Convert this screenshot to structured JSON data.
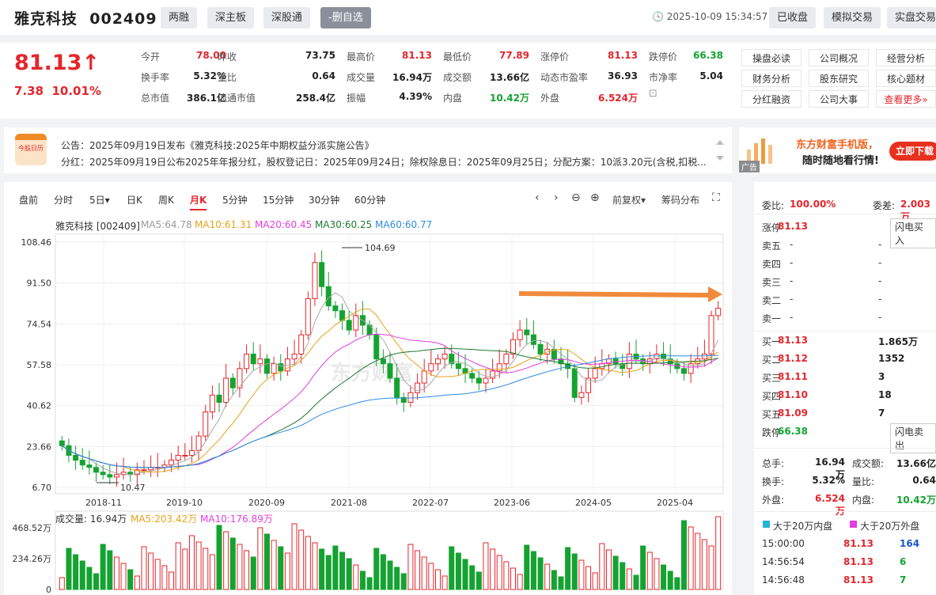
{
  "header": {
    "name": "雅克科技",
    "code": "002409",
    "tags": [
      "两融",
      "深主板",
      "深股通",
      "-删自选"
    ],
    "datetime": "2025-10-09 15:34:57",
    "buttons": [
      "已收盘",
      "模拟交易",
      "实盘交易"
    ]
  },
  "quote": {
    "price": "81.13↑",
    "change": "7.38",
    "change_pct": "10.01%",
    "rows": [
      [
        [
          "今开",
          "78.00",
          "red"
        ],
        [
          "昨收",
          "73.75",
          "black"
        ],
        [
          "最高价",
          "81.13",
          "red"
        ],
        [
          "最低价",
          "77.89",
          "red"
        ],
        [
          "涨停价",
          "81.13",
          "red"
        ],
        [
          "跌停价",
          "66.38",
          "green"
        ]
      ],
      [
        [
          "换手率",
          "5.32%",
          "black"
        ],
        [
          "量比",
          "0.64",
          "black"
        ],
        [
          "成交量",
          "16.94万",
          "black"
        ],
        [
          "成交额",
          "13.66亿",
          "black"
        ],
        [
          "动态市盈率",
          "36.93",
          "black"
        ],
        [
          "市净率",
          "5.04",
          "black"
        ]
      ],
      [
        [
          "总市值",
          "386.1亿",
          "black"
        ],
        [
          "流通市值",
          "258.4亿",
          "black"
        ],
        [
          "振幅",
          "4.39%",
          "black"
        ],
        [
          "内盘",
          "10.42万",
          "green"
        ],
        [
          "外盘",
          "6.524万",
          "red"
        ],
        [
          "",
          ""
        ]
      ]
    ],
    "links": [
      "操盘必读",
      "公司概况",
      "经营分析",
      "财务分析",
      "股东研究",
      "核心题材",
      "分红融资",
      "公司大事",
      "查看更多»"
    ]
  },
  "notice": {
    "icon_text": "今股日历",
    "line1": "公告：2025年09月19日发布《雅克科技:2025年中期权益分派实施公告》",
    "line2": "分红：2025年09月19日公布2025年年报分红，股权登记日：2025年09月24日；除权除息日：2025年09月25日；分配方案：10派3.20元(含税,扣税..."
  },
  "ad": {
    "line1": "东方财富手机版，",
    "line2": "随时随地看行情!",
    "button": "立即下载",
    "badge": "广告"
  },
  "chart": {
    "tabs": [
      "盘前",
      "分时",
      "5日▾",
      "日K",
      "周K",
      "月K",
      "5分钟",
      "15分钟",
      "30分钟",
      "60分钟"
    ],
    "active_tab": "月K",
    "tools": [
      "‹",
      "›",
      "⊖",
      "⊕",
      "前复权▾",
      "筹码分布",
      "⛶"
    ],
    "legend": {
      "name": "雅克科技 [002409]",
      "ma": [
        [
          "MA5:64.78",
          "#999999"
        ],
        [
          "MA10:61.31",
          "#e8a317"
        ],
        [
          "MA20:60.45",
          "#e23ee0"
        ],
        [
          "MA30:60.25",
          "#1f7a2e"
        ],
        [
          "MA60:60.77",
          "#2f8be0"
        ]
      ]
    },
    "y_labels": [
      "108.46",
      "91.50",
      "74.54",
      "57.58",
      "40.62",
      "23.66",
      "6.70"
    ],
    "x_labels": [
      "2018-11",
      "2019-10",
      "2020-09",
      "2021-08",
      "2022-07",
      "2023-06",
      "2024-05",
      "2025-04"
    ],
    "high_label": "104.69",
    "low_label": "10.47",
    "vol_legend": [
      [
        "成交量: 16.94万",
        "#333333"
      ],
      [
        "MA5:203.42万",
        "#e8a317"
      ],
      [
        "MA10:176.89万",
        "#e23ee0"
      ]
    ],
    "vol_y_labels": [
      "468.52万",
      "234.26万",
      "0"
    ],
    "watermark": "东方财富",
    "colors": {
      "up": "#e4262c",
      "down": "#14a331"
    }
  },
  "chart_data": {
    "type": "candlestick",
    "ylim": [
      6.7,
      108.46
    ],
    "high": 104.69,
    "low": 10.47,
    "last": 81.13
  },
  "side": {
    "wb": [
      [
        "委比:",
        "100.00%"
      ],
      [
        "委差:",
        "2.003万"
      ]
    ],
    "zt": [
      "涨停",
      "81.13",
      "闪电买入"
    ],
    "asks": [
      [
        "卖五",
        "-",
        "-"
      ],
      [
        "卖四",
        "-",
        "-"
      ],
      [
        "卖三",
        "-",
        "-"
      ],
      [
        "卖二",
        "-",
        "-"
      ],
      [
        "卖一",
        "-",
        "-"
      ]
    ],
    "bids": [
      [
        "买一",
        "81.13",
        "1.865万"
      ],
      [
        "买二",
        "81.12",
        "1352"
      ],
      [
        "买三",
        "81.11",
        "3"
      ],
      [
        "买四",
        "81.10",
        "18"
      ],
      [
        "买五",
        "81.09",
        "7"
      ]
    ],
    "dt": [
      "跌停",
      "66.38",
      "闪电卖出"
    ],
    "stats": [
      [
        "总手:",
        "16.94万",
        "成交额:",
        "13.66亿"
      ],
      [
        "换手:",
        "5.32%",
        "量比:",
        "0.64"
      ],
      [
        "外盘:",
        "6.524万",
        "内盘:",
        "10.42万"
      ]
    ],
    "big_legend": [
      "大于20万内盘",
      "大于20万外盘"
    ],
    "trades": [
      [
        "15:00:00",
        "81.13",
        "164",
        "blue"
      ],
      [
        "14:56:54",
        "81.13",
        "6",
        "green"
      ],
      [
        "14:56:48",
        "81.13",
        "7",
        "green"
      ]
    ]
  }
}
